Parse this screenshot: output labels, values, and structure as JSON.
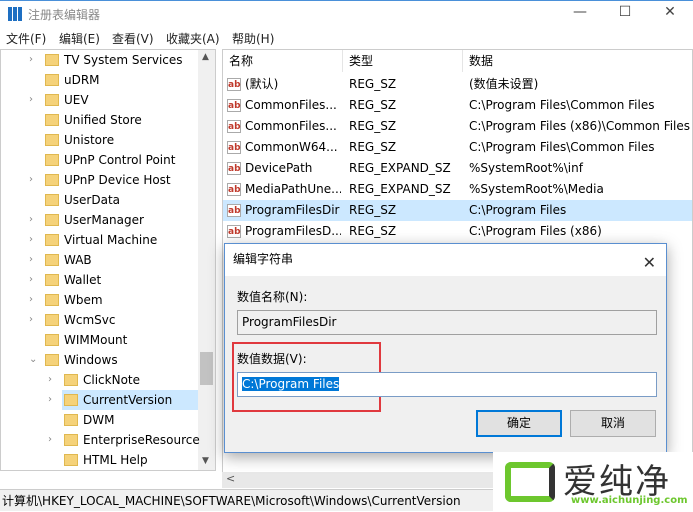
{
  "window": {
    "title": "注册表编辑器",
    "min": "—",
    "max": "☐",
    "close": "✕"
  },
  "menu": [
    "文件(F)",
    "编辑(E)",
    "查看(V)",
    "收藏夹(A)",
    "帮助(H)"
  ],
  "tree": [
    {
      "label": "TV System Services",
      "expandable": true,
      "level": 1
    },
    {
      "label": "uDRM",
      "expandable": false,
      "level": 1
    },
    {
      "label": "UEV",
      "expandable": true,
      "level": 1
    },
    {
      "label": "Unified Store",
      "expandable": false,
      "level": 1
    },
    {
      "label": "Unistore",
      "expandable": false,
      "level": 1
    },
    {
      "label": "UPnP Control Point",
      "expandable": false,
      "level": 1
    },
    {
      "label": "UPnP Device Host",
      "expandable": true,
      "level": 1
    },
    {
      "label": "UserData",
      "expandable": false,
      "level": 1
    },
    {
      "label": "UserManager",
      "expandable": true,
      "level": 1
    },
    {
      "label": "Virtual Machine",
      "expandable": true,
      "level": 1
    },
    {
      "label": "WAB",
      "expandable": true,
      "level": 1
    },
    {
      "label": "Wallet",
      "expandable": true,
      "level": 1
    },
    {
      "label": "Wbem",
      "expandable": true,
      "level": 1
    },
    {
      "label": "WcmSvc",
      "expandable": true,
      "level": 1
    },
    {
      "label": "WIMMount",
      "expandable": false,
      "level": 1
    },
    {
      "label": "Windows",
      "expandable": true,
      "expanded": true,
      "level": 1
    },
    {
      "label": "ClickNote",
      "expandable": true,
      "level": 2
    },
    {
      "label": "CurrentVersion",
      "expandable": true,
      "level": 2,
      "selected": true
    },
    {
      "label": "DWM",
      "expandable": false,
      "level": 2
    },
    {
      "label": "EnterpriseResource",
      "expandable": true,
      "level": 2
    },
    {
      "label": "HTML Help",
      "expandable": false,
      "level": 2
    }
  ],
  "list": {
    "headers": [
      "名称",
      "类型",
      "数据"
    ],
    "rows": [
      {
        "name": "(默认)",
        "type": "REG_SZ",
        "data": "(数值未设置)"
      },
      {
        "name": "CommonFiles...",
        "type": "REG_SZ",
        "data": "C:\\Program Files\\Common Files"
      },
      {
        "name": "CommonFiles...",
        "type": "REG_SZ",
        "data": "C:\\Program Files (x86)\\Common Files"
      },
      {
        "name": "CommonW64...",
        "type": "REG_SZ",
        "data": "C:\\Program Files\\Common Files"
      },
      {
        "name": "DevicePath",
        "type": "REG_EXPAND_SZ",
        "data": "%SystemRoot%\\inf"
      },
      {
        "name": "MediaPathUne...",
        "type": "REG_EXPAND_SZ",
        "data": "%SystemRoot%\\Media"
      },
      {
        "name": "ProgramFilesDir",
        "type": "REG_SZ",
        "data": "C:\\Program Files",
        "selected": true
      },
      {
        "name": "ProgramFilesD...",
        "type": "REG_SZ",
        "data": "C:\\Program Files (x86)"
      }
    ]
  },
  "dialog": {
    "title": "编辑字符串",
    "name_label": "数值名称(N):",
    "name_value": "ProgramFilesDir",
    "data_label": "数值数据(V):",
    "data_value": "C:\\Program Files",
    "ok": "确定",
    "cancel": "取消",
    "close": "✕"
  },
  "status": "计算机\\HKEY_LOCAL_MACHINE\\SOFTWARE\\Microsoft\\Windows\\CurrentVersion",
  "watermark": {
    "text": "爱纯净",
    "url": "www.aichunjing.com"
  },
  "colors": {
    "selection": "#0078d7",
    "highlight_box": "#e0393e",
    "row_selected": "#cce8ff"
  }
}
